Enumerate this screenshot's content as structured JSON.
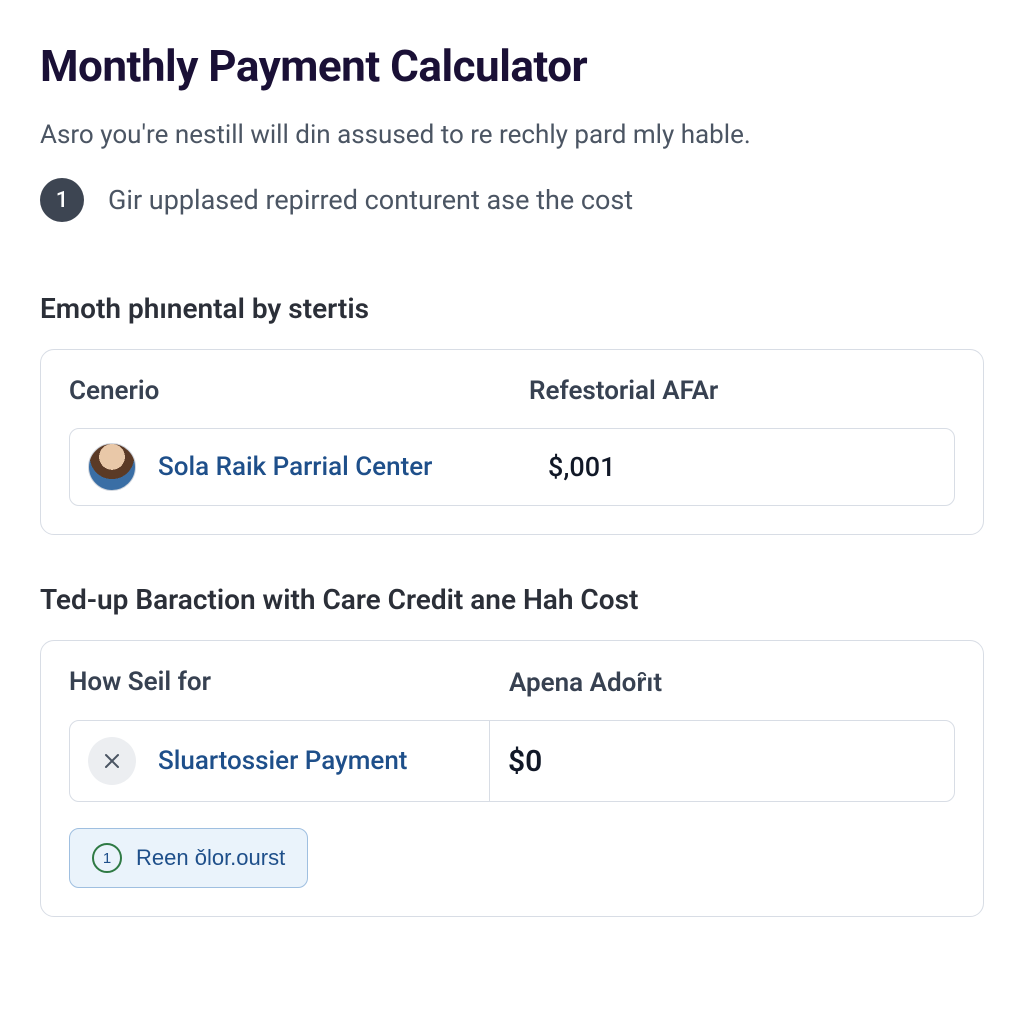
{
  "header": {
    "title": "Monthly Payment Calculator",
    "subtitle": "Asro you're nestill will din assused to re rechly pard mly hable."
  },
  "step": {
    "number": "1",
    "text": "Gir upplased repirred conturent ase the cost"
  },
  "section1": {
    "heading": "Emoth phınental by stertis",
    "col_left_header": "Cenerio",
    "col_right_header": "Refestorial AFAr",
    "row": {
      "label": "Sola Raik Parrial Center",
      "value": "$,001"
    }
  },
  "section2": {
    "heading": "Ted-up Baraction with Care Credit ane Hah Cost",
    "col_left_header": "How Seil for",
    "col_right_header": "Apena Adoȓıt",
    "row": {
      "icon": "close-icon",
      "label": "Sluartossier Payment",
      "value": "$0"
    },
    "button": {
      "icon_text": "1",
      "label": "Reen ǒlor.ourst"
    }
  }
}
